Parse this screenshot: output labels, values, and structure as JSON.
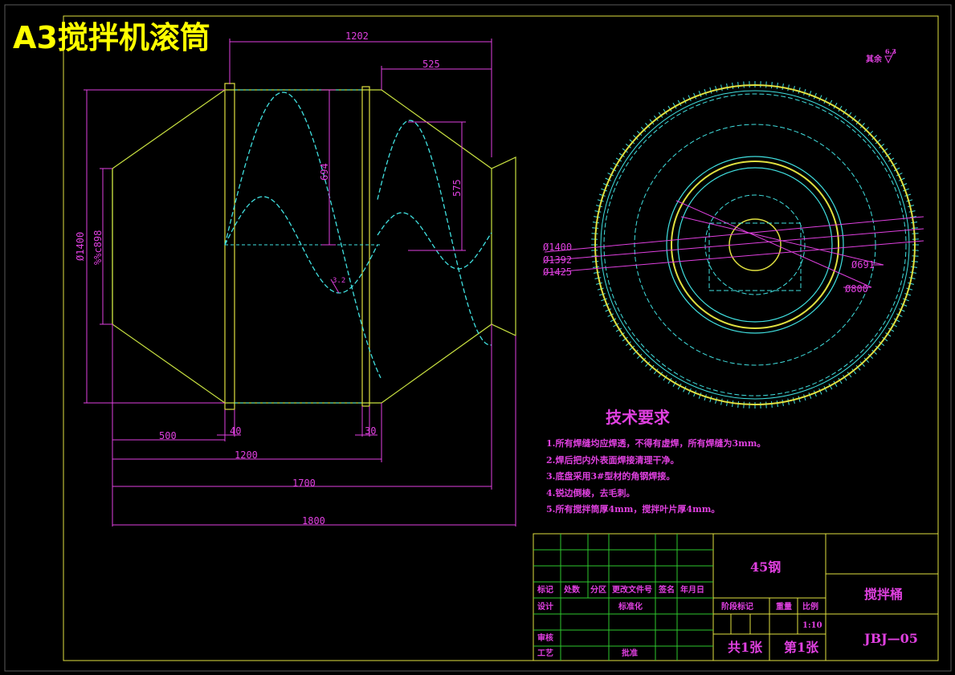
{
  "title": "A3搅拌机滚筒",
  "surface_note": {
    "label": "其余",
    "value": "6.3"
  },
  "dimensions_side": {
    "overall_top": "1202",
    "right_top": "525",
    "inner_height_1": "694",
    "inner_height_2": "575",
    "outer_dia": "Ø1400",
    "inner_dia": "%%c898",
    "thickness": "3.2",
    "dim_500": "500",
    "dim_40": "40",
    "dim_30": "30",
    "dim_1200": "1200",
    "dim_1700": "1700",
    "dim_1800": "1800"
  },
  "dimensions_end": {
    "d1400": "Ø1400",
    "d1392": "Ø1392",
    "d1425": "Ø1425",
    "d691": "Ø691",
    "d800": "Ø800"
  },
  "tech_requirements": {
    "heading": "技术要求",
    "items": [
      "1.所有焊缝均应焊透，不得有虚焊，所有焊缝为3mm。",
      "2.焊后把内外表面焊接清理干净。",
      "3.底盘采用3#型材的角钢焊接。",
      "4.锐边倒棱，去毛刺。",
      "5.所有搅拌筒厚4mm，搅拌叶片厚4mm。"
    ]
  },
  "title_block": {
    "material": "45钢",
    "part_name": "搅拌桶",
    "drawing_no": "JBJ—05",
    "rev_headers": [
      "标记",
      "处数",
      "分区",
      "更改文件号",
      "签名",
      "年月日"
    ],
    "design": "设计",
    "standard": "标准化",
    "review": "审核",
    "process": "工艺",
    "approve": "批准",
    "stage_label": "阶段标记",
    "weight_label": "重量",
    "scale_label": "比例",
    "scale_value": "1:10",
    "total_sheets": "共1张",
    "sheet_no": "第1张"
  }
}
